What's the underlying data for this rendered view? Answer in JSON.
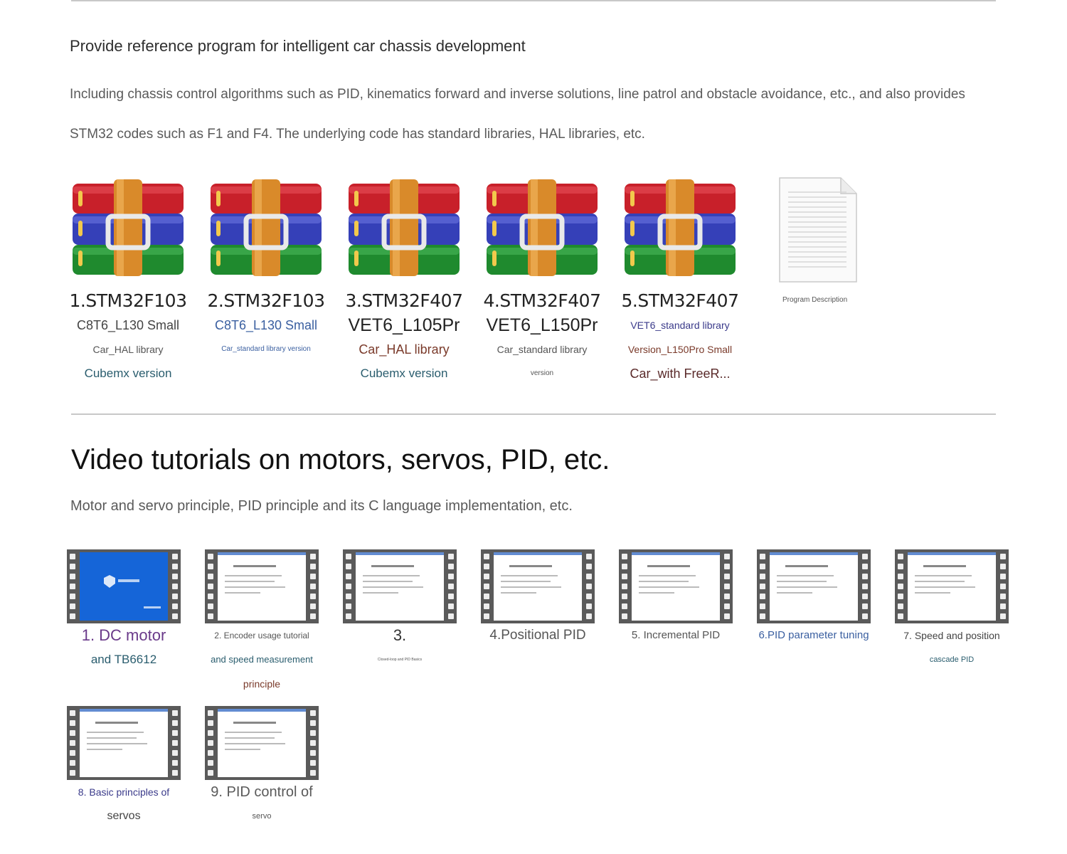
{
  "section1": {
    "heading": "Provide reference program for intelligent car chassis development",
    "para_line1": "Including chassis control algorithms such as PID, kinematics forward and inverse solutions, line patrol and obstacle avoidance, etc., and also provides",
    "para_line2": "STM32 codes such as F1 and F4. The underlying code has standard libraries, HAL libraries, etc."
  },
  "files": [
    {
      "icon": "winrar-archive-icon",
      "lines": [
        "1.STM32F103",
        "C8T6_L130 Small",
        "Car_HAL library",
        "Cubemx version"
      ]
    },
    {
      "icon": "winrar-archive-icon",
      "lines": [
        "2.STM32F103",
        "C8T6_L130 Small",
        "Car_standard library version",
        ""
      ]
    },
    {
      "icon": "winrar-archive-icon",
      "lines": [
        "3.STM32F407",
        "VET6_L105Pr",
        "Car_HAL library",
        "Cubemx version"
      ]
    },
    {
      "icon": "winrar-archive-icon",
      "lines": [
        "4.STM32F407",
        "VET6_L150Pr",
        "Car_standard library",
        "version"
      ]
    },
    {
      "icon": "winrar-archive-icon",
      "lines": [
        "5.STM32F407",
        "VET6_standard library",
        "Version_L150Pro Small",
        "Car_with FreeR..."
      ]
    },
    {
      "icon": "document-icon",
      "lines": [
        "Program Description"
      ]
    }
  ],
  "section2": {
    "heading": "Video tutorials on motors, servos, PID, etc.",
    "para": "Motor and servo principle, PID principle and its C language implementation, etc."
  },
  "videos": [
    {
      "icon": "video-file-icon",
      "lines": [
        "1. DC motor",
        "and TB6612"
      ]
    },
    {
      "icon": "video-file-icon",
      "lines": [
        "2. Encoder usage tutorial",
        "and speed measurement",
        "principle"
      ]
    },
    {
      "icon": "video-file-icon",
      "lines": [
        "3.",
        "Closed-loop and PID Basics"
      ]
    },
    {
      "icon": "video-file-icon",
      "lines": [
        "4.Positional PID"
      ]
    },
    {
      "icon": "video-file-icon",
      "lines": [
        "5. Incremental PID"
      ]
    },
    {
      "icon": "video-file-icon",
      "lines": [
        "6.PID parameter tuning"
      ]
    },
    {
      "icon": "video-file-icon",
      "lines": [
        "7. Speed and position",
        "cascade PID"
      ]
    },
    {
      "icon": "video-file-icon",
      "lines": [
        "8. Basic principles of",
        "servos"
      ]
    },
    {
      "icon": "video-file-icon",
      "lines": [
        "9. PID control of",
        "servo"
      ]
    }
  ],
  "colors": {
    "rar_red": "#c8202a",
    "rar_blue": "#3540b8",
    "rar_green": "#1f8a2e",
    "rar_strap": "#d98a2a",
    "film": "#5a5a5a"
  }
}
